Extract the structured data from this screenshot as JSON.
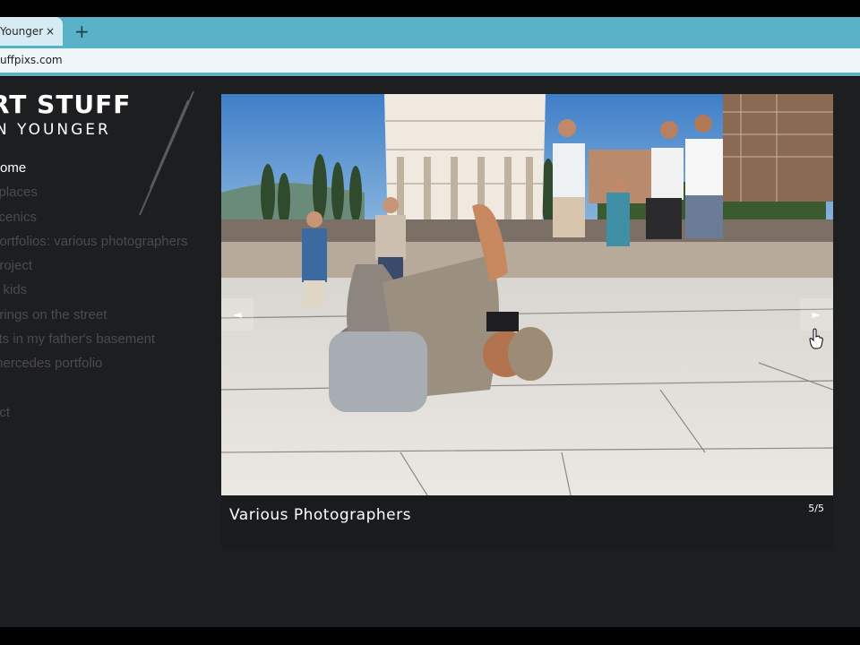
{
  "browser": {
    "tab_title": "Younger",
    "tab_close": "×",
    "new_tab": "+",
    "url": "uffpixs.com"
  },
  "site": {
    "title": "RT STUFF",
    "subtitle": "N YOUNGER"
  },
  "nav": {
    "items": [
      {
        "label": "ome"
      },
      {
        "label": "l places"
      },
      {
        "label": "scenics"
      },
      {
        "label": "portfolios: various photographers"
      },
      {
        "label": " project"
      },
      {
        "label": "o kids"
      },
      {
        "label": "erings on the street"
      },
      {
        "label": "cts in my father's basement"
      },
      {
        "label": "mercedes portfolio"
      },
      {
        "label": ""
      },
      {
        "label": "act"
      }
    ]
  },
  "slideshow": {
    "caption": "Various Photographers",
    "counter": "5/5",
    "prev_label": "◄",
    "next_label": "►"
  }
}
